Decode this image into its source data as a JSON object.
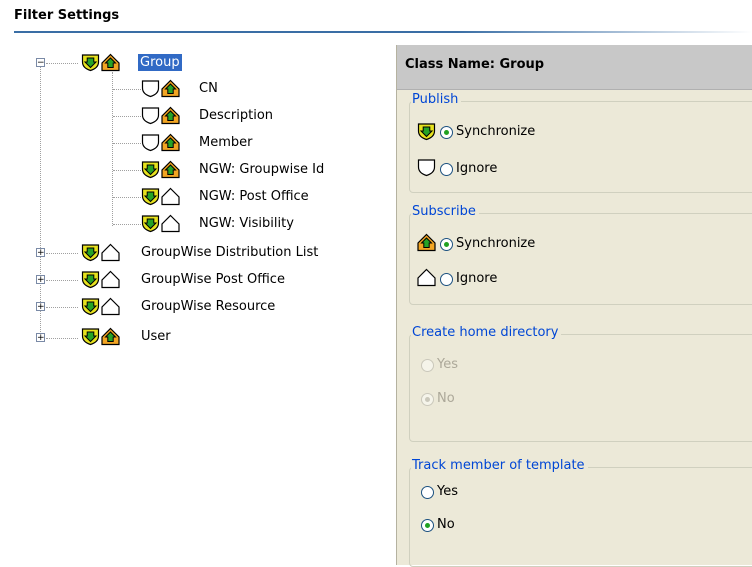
{
  "title": "Filter Settings",
  "tree": {
    "nodes": [
      {
        "label": "Group"
      },
      {
        "label": "CN"
      },
      {
        "label": "Description"
      },
      {
        "label": "Member"
      },
      {
        "label": "NGW: Groupwise Id"
      },
      {
        "label": "NGW: Post Office"
      },
      {
        "label": "NGW: Visibility"
      },
      {
        "label": "GroupWise Distribution List"
      },
      {
        "label": "GroupWise Post Office"
      },
      {
        "label": "GroupWise Resource"
      },
      {
        "label": "User"
      }
    ],
    "collapse_symbol": "−",
    "expand_symbol": "+"
  },
  "panel": {
    "header": "Class Name: Group",
    "publish": {
      "legend": "Publish",
      "synchronize": "Synchronize",
      "ignore": "Ignore",
      "selected": "synchronize"
    },
    "subscribe": {
      "legend": "Subscribe",
      "synchronize": "Synchronize",
      "ignore": "Ignore",
      "selected": "synchronize"
    },
    "home_directory": {
      "legend": "Create home directory",
      "yes": "Yes",
      "no": "No",
      "selected": "no",
      "enabled": false
    },
    "track_member": {
      "legend": "Track member of template",
      "yes": "Yes",
      "no": "No",
      "selected": "no"
    }
  },
  "colors": {
    "selection": "#316ac5",
    "legend": "#0046d5",
    "radio_dot": "#21a121",
    "publish_icon": "#e6e21e",
    "subscribe_icon": "#f2a522"
  }
}
